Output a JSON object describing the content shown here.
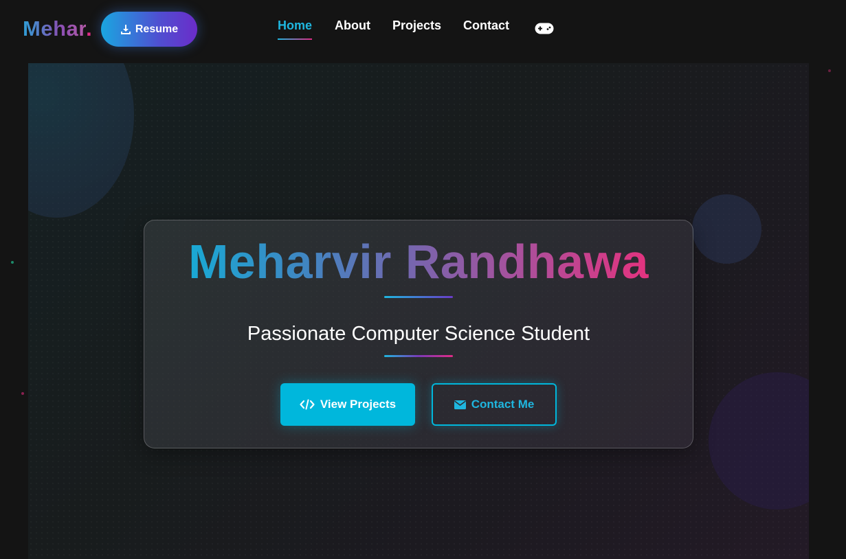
{
  "navbar": {
    "logo_text": "Mehar",
    "logo_dot": ".",
    "resume_label": "Resume",
    "links": [
      {
        "label": "Home",
        "active": true
      },
      {
        "label": "About",
        "active": false
      },
      {
        "label": "Projects",
        "active": false
      },
      {
        "label": "Contact",
        "active": false
      }
    ],
    "game_icon": "gamepad-icon"
  },
  "hero": {
    "name": "Meharvir Randhawa",
    "subtitle": "Passionate Computer Science Student",
    "primary_button": {
      "label": "View Projects",
      "icon": "code-icon"
    },
    "secondary_button": {
      "label": "Contact Me",
      "icon": "envelope-icon"
    }
  },
  "colors": {
    "accent": "#00b7dc",
    "pink": "#e02b86",
    "purple": "#6b2cc9",
    "background": "#141414"
  }
}
